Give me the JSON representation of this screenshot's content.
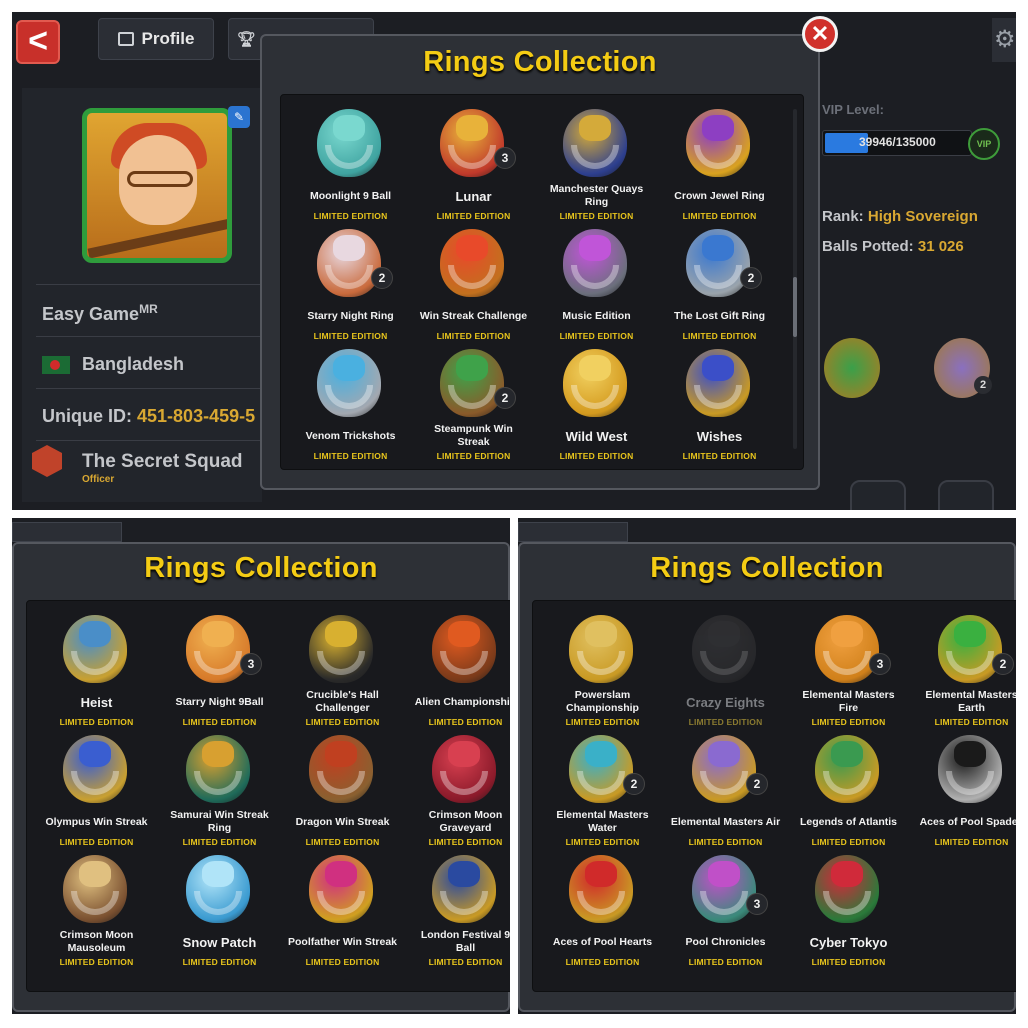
{
  "profile": {
    "back_label": "<",
    "tab_profile": "Profile",
    "player_name": "Easy Game",
    "player_name_sup": "MR",
    "country": "Bangladesh",
    "unique_id_label": "Unique ID:",
    "unique_id": "451-803-459-5",
    "club_name": "The Secret Squad",
    "club_role": "Officer",
    "vip_label": "VIP Level:",
    "vip_progress": "39946/135000",
    "vip_progress_fraction": 0.296,
    "vip_badge": "VIP",
    "rank_label": "Rank:",
    "rank_value": "High Sovereign",
    "balls_label": "Balls Potted:",
    "balls_value": "31 026",
    "bg_ring_count": "2"
  },
  "dialog_title": "Rings Collection",
  "close_label": "✕",
  "panels": [
    {
      "rings": [
        {
          "name": "Moonlight 9 Ball",
          "tag": "LIMITED EDITION",
          "count": "",
          "color": "#3fa3a0",
          "gem": "#7ad8cf",
          "big": false
        },
        {
          "name": "Lunar",
          "tag": "LIMITED EDITION",
          "count": "3",
          "color": "#c0392b",
          "gem": "#e8b23a",
          "big": true
        },
        {
          "name": "Manchester Quays Ring",
          "tag": "LIMITED EDITION",
          "count": "",
          "color": "#2d3f8f",
          "gem": "#d4aa3a",
          "big": false
        },
        {
          "name": "Crown Jewel Ring",
          "tag": "LIMITED EDITION",
          "count": "",
          "color": "#d9a21f",
          "gem": "#8d3fc2",
          "big": false
        },
        {
          "name": "Starry Night Ring",
          "tag": "LIMITED EDITION",
          "count": "2",
          "color": "#c96a3c",
          "gem": "#e8d8e0",
          "big": false
        },
        {
          "name": "Win Streak Challenge",
          "tag": "LIMITED EDITION",
          "count": "",
          "color": "#c2701e",
          "gem": "#e84a2a",
          "big": false
        },
        {
          "name": "Music Edition",
          "tag": "LIMITED EDITION",
          "count": "",
          "color": "#6b6f7c",
          "gem": "#c055d8",
          "big": false
        },
        {
          "name": "The Lost Gift Ring",
          "tag": "LIMITED EDITION",
          "count": "2",
          "color": "#9aa3ab",
          "gem": "#3a78d0",
          "big": false
        },
        {
          "name": "Venom Trickshots",
          "tag": "LIMITED EDITION",
          "count": "",
          "color": "#a3a8b0",
          "gem": "#4ab0e0",
          "big": false
        },
        {
          "name": "Steampunk Win Streak",
          "tag": "LIMITED EDITION",
          "count": "2",
          "color": "#8a5a2a",
          "gem": "#3fa24a",
          "big": false
        },
        {
          "name": "Wild West",
          "tag": "LIMITED EDITION",
          "count": "",
          "color": "#d49a1e",
          "gem": "#f1d060",
          "big": true
        },
        {
          "name": "Wishes",
          "tag": "LIMITED EDITION",
          "count": "",
          "color": "#c99a24",
          "gem": "#3b4fc8",
          "big": true
        }
      ]
    },
    {
      "rings": [
        {
          "name": "Heist",
          "tag": "LIMITED EDITION",
          "count": "",
          "color": "#c9a030",
          "gem": "#4a8ec8",
          "big": true
        },
        {
          "name": "Starry Night 9Ball",
          "tag": "LIMITED EDITION",
          "count": "3",
          "color": "#d77a2a",
          "gem": "#f0b050",
          "big": false
        },
        {
          "name": "Crucible's Hall Challenger",
          "tag": "LIMITED EDITION",
          "count": "",
          "color": "#2a2a2a",
          "gem": "#d8b030",
          "big": false
        },
        {
          "name": "Alien Championship",
          "tag": "LIMITED EDITION",
          "count": "",
          "color": "#7a3a1a",
          "gem": "#e05a20",
          "big": false
        },
        {
          "name": "Olympus Win Streak",
          "tag": "LIMITED EDITION",
          "count": "",
          "color": "#c9a030",
          "gem": "#3a5ed0",
          "big": false
        },
        {
          "name": "Samurai Win Streak Ring",
          "tag": "LIMITED EDITION",
          "count": "",
          "color": "#1f6b5a",
          "gem": "#d8a030",
          "big": false
        },
        {
          "name": "Dragon Win Streak",
          "tag": "LIMITED EDITION",
          "count": "",
          "color": "#8a6030",
          "gem": "#c04020",
          "big": false
        },
        {
          "name": "Crimson Moon Graveyard",
          "tag": "LIMITED EDITION",
          "count": "",
          "color": "#8a1a2a",
          "gem": "#d84050",
          "big": false
        },
        {
          "name": "Crimson Moon Mausoleum",
          "tag": "LIMITED EDITION",
          "count": "",
          "color": "#7a5030",
          "gem": "#e0c080",
          "big": false
        },
        {
          "name": "Snow Patch",
          "tag": "LIMITED EDITION",
          "count": "",
          "color": "#3a9ad0",
          "gem": "#b0e4f8",
          "big": true
        },
        {
          "name": "Poolfather Win Streak",
          "tag": "LIMITED EDITION",
          "count": "",
          "color": "#d0a020",
          "gem": "#d03080",
          "big": false
        },
        {
          "name": "London Festival 9 Ball",
          "tag": "LIMITED EDITION",
          "count": "",
          "color": "#c99a24",
          "gem": "#2a4aa0",
          "big": false
        }
      ]
    },
    {
      "rings": [
        {
          "name": "Powerslam Championship",
          "tag": "LIMITED EDITION",
          "count": "",
          "color": "#c99a24",
          "gem": "#e0c060",
          "big": false
        },
        {
          "name": "Crazy Eights",
          "tag": "LIMITED EDITION",
          "count": "",
          "color": "#3a3a3c",
          "gem": "#4a4a4c",
          "big": true,
          "dim": true
        },
        {
          "name": "Elemental Masters Fire",
          "tag": "LIMITED EDITION",
          "count": "3",
          "color": "#d0801a",
          "gem": "#f0a040",
          "big": false
        },
        {
          "name": "Elemental Masters Earth",
          "tag": "LIMITED EDITION",
          "count": "2",
          "color": "#c99a24",
          "gem": "#3ab040",
          "big": false
        },
        {
          "name": "Elemental Masters Water",
          "tag": "LIMITED EDITION",
          "count": "2",
          "color": "#c99a24",
          "gem": "#3ab0c8",
          "big": false
        },
        {
          "name": "Elemental Masters Air",
          "tag": "LIMITED EDITION",
          "count": "2",
          "color": "#c99a24",
          "gem": "#8a6ad0",
          "big": false
        },
        {
          "name": "Legends of Atlantis",
          "tag": "LIMITED EDITION",
          "count": "",
          "color": "#c99a24",
          "gem": "#3a9a50",
          "big": false
        },
        {
          "name": "Aces of Pool Spades",
          "tag": "LIMITED EDITION",
          "count": "",
          "color": "#b0b0b0",
          "gem": "#1a1a1a",
          "big": false
        },
        {
          "name": "Aces of Pool Hearts",
          "tag": "LIMITED EDITION",
          "count": "",
          "color": "#c99a24",
          "gem": "#d02a2a",
          "big": false
        },
        {
          "name": "Pool Chronicles",
          "tag": "LIMITED EDITION",
          "count": "3",
          "color": "#3a8a7a",
          "gem": "#c050c8",
          "big": false
        },
        {
          "name": "Cyber Tokyo",
          "tag": "LIMITED EDITION",
          "count": "",
          "color": "#2a7a3a",
          "gem": "#d02a3a",
          "big": true
        }
      ]
    }
  ]
}
